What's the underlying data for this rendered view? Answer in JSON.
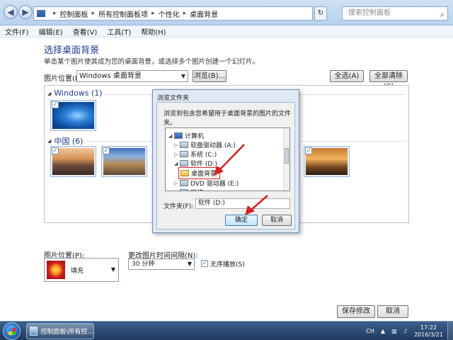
{
  "window": {
    "breadcrumbs": [
      "控制面板",
      "所有控制面板项",
      "个性化",
      "桌面背景"
    ],
    "search_placeholder": "搜索控制面板",
    "nav_back_icon": "back-arrow-icon",
    "nav_forward_icon": "forward-arrow-icon"
  },
  "menu": [
    "文件(F)",
    "编辑(E)",
    "查看(V)",
    "工具(T)",
    "帮助(H)"
  ],
  "main": {
    "title": "选择桌面背景",
    "description": "单击某个图片使其成为您的桌面背景，或选择多个图片创建一个幻灯片。",
    "location_label": "图片位置(L):",
    "location_value": "Windows 桌面背景",
    "browse_label": "浏览(B)...",
    "select_all_label": "全选(A)",
    "clear_all_label": "全部清除(C)",
    "groups": [
      {
        "name": "Windows (1)"
      },
      {
        "name": "中国 (6)"
      }
    ],
    "check_mark": "✓"
  },
  "dialog": {
    "title": "浏览文件夹",
    "prompt": "浏览到包含您希望用于桌面背景的图片的文件夹。",
    "tree": [
      {
        "label": "计算机"
      },
      {
        "label": "软盘驱动器 (A:)"
      },
      {
        "label": "系统 (C:)"
      },
      {
        "label": "软件 (D:)"
      },
      {
        "label": "桌面背景"
      },
      {
        "label": "DVD 驱动器 (E:)"
      },
      {
        "label": "网络"
      }
    ],
    "folder_label": "文件夹(F):",
    "folder_value": "软件 (D:)",
    "ok_label": "确定",
    "cancel_label": "取消"
  },
  "bottom": {
    "position_label": "图片位置(P):",
    "position_value": "填充",
    "interval_label": "更改图片时间间隔(N):",
    "interval_value": "30 分钟",
    "shuffle_label": "无序播放(S)",
    "shuffle_checked": true,
    "save_label": "保存修改",
    "cancel_label": "取消"
  },
  "taskbar": {
    "task_label": "控制面板\\所有控...",
    "lang": "CH",
    "time": "17:22",
    "date": "2016/3/21"
  },
  "colors": {
    "accent": "#1e3a8a",
    "annotation_red": "#d22222"
  }
}
